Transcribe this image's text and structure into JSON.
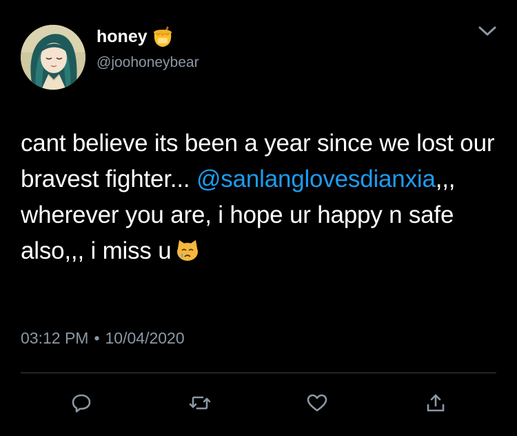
{
  "user": {
    "display_name": "honey",
    "handle": "@joohoneybear",
    "name_emoji": "honey-pot-icon"
  },
  "tweet": {
    "text_before_mention": "cant believe its been a year since we lost our bravest fighter... ",
    "mention": "@sanlanglovesdianxia",
    "text_after_mention": ",,, wherever you are, i hope ur happy n safe also,,, i miss u",
    "trailing_emoji": "crying-cat-face-icon"
  },
  "meta": {
    "time": "03:12 PM",
    "separator": "•",
    "date": "10/04/2020"
  },
  "actions": [
    "reply-icon",
    "retweet-icon",
    "like-icon",
    "share-icon"
  ],
  "colors": {
    "background": "#000000",
    "text": "#ffffff",
    "secondary": "#8b98a5",
    "link": "#1d9bf0",
    "divider": "#38444d"
  }
}
